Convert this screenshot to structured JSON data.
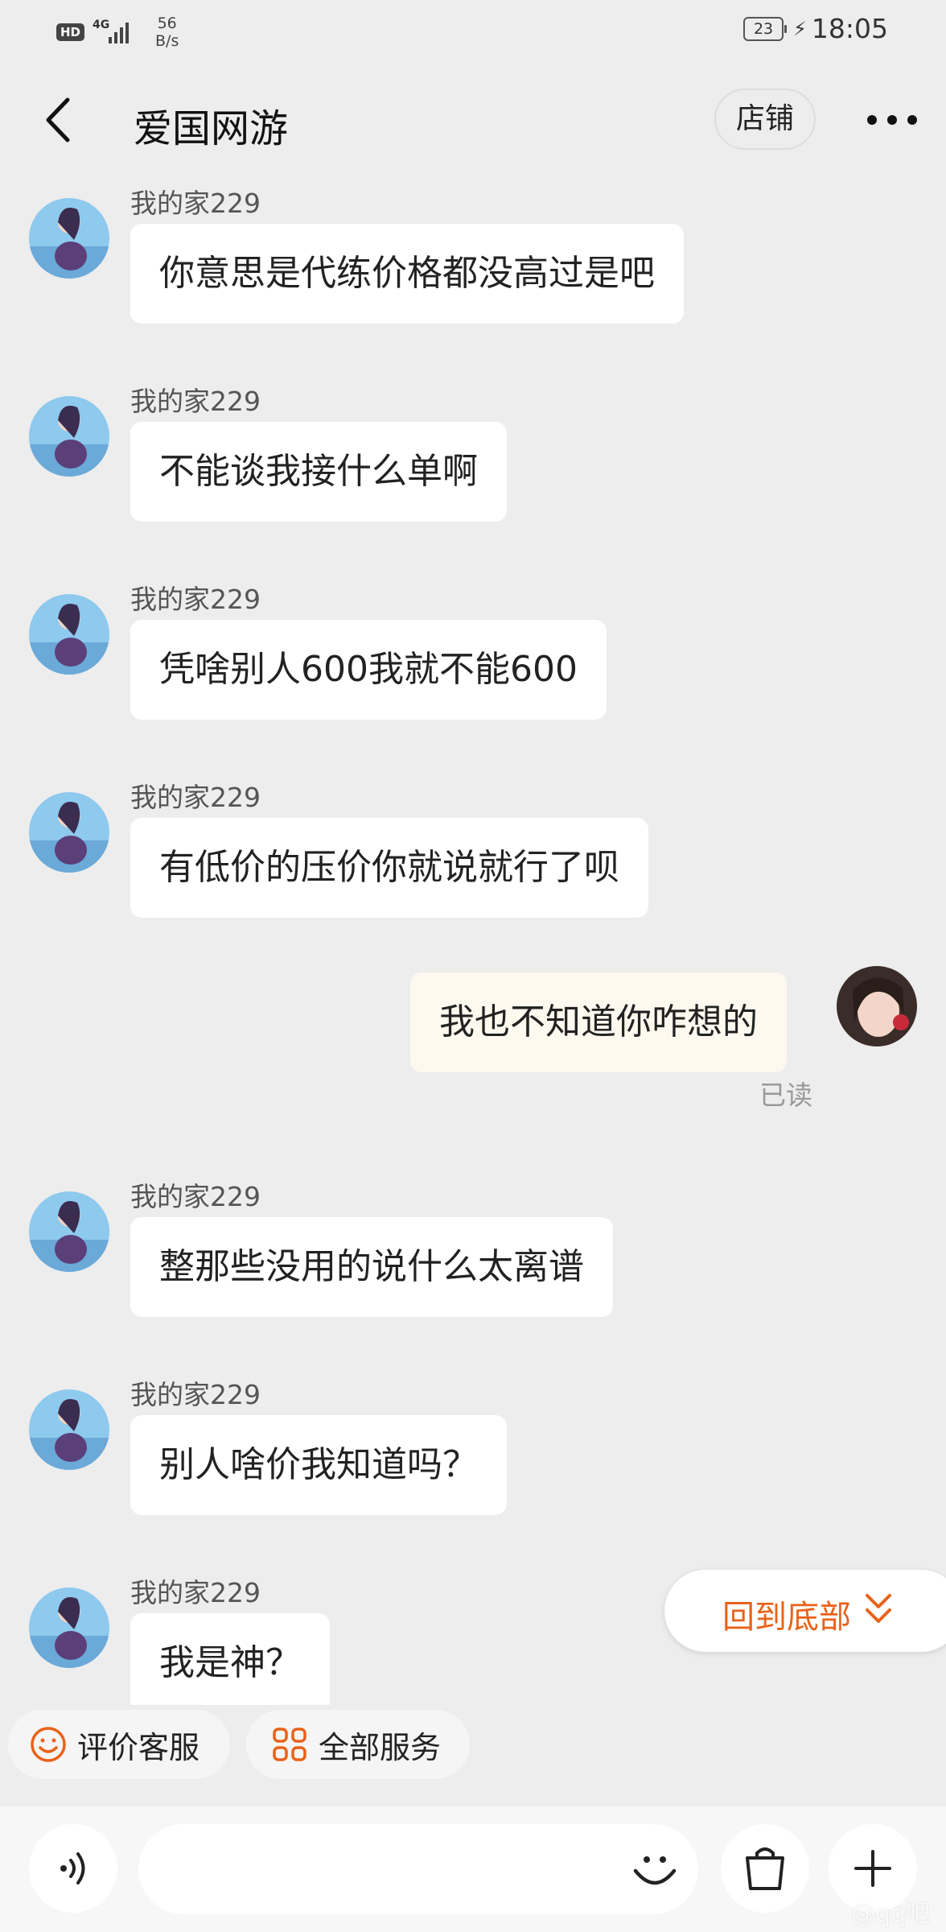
{
  "status_bar": {
    "hd": "HD",
    "network": "4G",
    "speed_value": "56",
    "speed_unit": "B/s",
    "battery": "23",
    "time": "18:05"
  },
  "header": {
    "title": "爱国网游",
    "shop_label": "店铺"
  },
  "chat": {
    "messages": [
      {
        "side": "left",
        "sender": "我的家229",
        "text": "你意思是代练价格都没高过是吧"
      },
      {
        "side": "left",
        "sender": "我的家229",
        "text": "不能谈我接什么单啊"
      },
      {
        "side": "left",
        "sender": "我的家229",
        "text": "凭啥别人600我就不能600"
      },
      {
        "side": "left",
        "sender": "我的家229",
        "text": "有低价的压价你就说就行了呗"
      },
      {
        "side": "right",
        "sender": "",
        "text": "我也不知道你咋想的",
        "status": "已读"
      },
      {
        "side": "left",
        "sender": "我的家229",
        "text": "整那些没用的说什么太离谱"
      },
      {
        "side": "left",
        "sender": "我的家229",
        "text": "别人啥价我知道吗？"
      },
      {
        "side": "left",
        "sender": "我的家229",
        "text": "我是神？"
      }
    ],
    "scroll_bottom_label": "回到底部"
  },
  "quick_actions": {
    "rate": "评价客服",
    "services": "全部服务"
  },
  "input": {
    "placeholder": ""
  },
  "watermark": "@qq吧",
  "colors": {
    "accent": "#e9621a",
    "background": "#ededed",
    "bubble_left": "#ffffff",
    "bubble_right": "#fdf9ef"
  }
}
